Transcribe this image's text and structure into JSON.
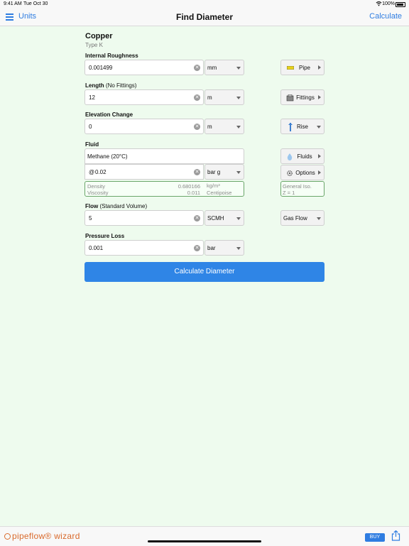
{
  "status_bar": {
    "time": "9:41 AM",
    "date": "Tue Oct 30",
    "battery": "100%"
  },
  "nav": {
    "units_label": "Units",
    "title": "Find Diameter",
    "calculate_label": "Calculate"
  },
  "pipe": {
    "material": "Copper",
    "type": "Type K"
  },
  "roughness": {
    "label": "Internal Roughness",
    "value": "0.001499",
    "unit": "mm",
    "button": "Pipe"
  },
  "length": {
    "label": "Length",
    "sublabel": "(No Fittings)",
    "value": "12",
    "unit": "m",
    "button": "Fittings"
  },
  "elevation": {
    "label": "Elevation Change",
    "value": "0",
    "unit": "m",
    "button": "Rise"
  },
  "fluid": {
    "label": "Fluid",
    "name": "Methane (20°C)",
    "pressure_prefix": "@",
    "pressure_value": "0.02",
    "pressure_unit": "bar g",
    "fluids_button": "Fluids",
    "options_button": "Options",
    "density_label": "Density",
    "density_value": "0.680166",
    "density_unit": "kg/m³",
    "viscosity_label": "Viscosity",
    "viscosity_value": "0.011",
    "viscosity_unit": "Centipoise",
    "model_line1": "General Iso.",
    "model_line2": "Z = 1"
  },
  "flow": {
    "label": "Flow",
    "sublabel": "(Standard Volume)",
    "value": "5",
    "unit": "SCMH",
    "button": "Gas Flow"
  },
  "pressure_loss": {
    "label": "Pressure Loss",
    "value": "0.001",
    "unit": "bar"
  },
  "calculate_button": "Calculate Diameter",
  "footer": {
    "logo_text": "pipeflow® wizard",
    "buy_label": "BUY"
  },
  "colors": {
    "accent": "#2f7de1",
    "background": "#eefbee",
    "logo": "#d96a2c"
  }
}
